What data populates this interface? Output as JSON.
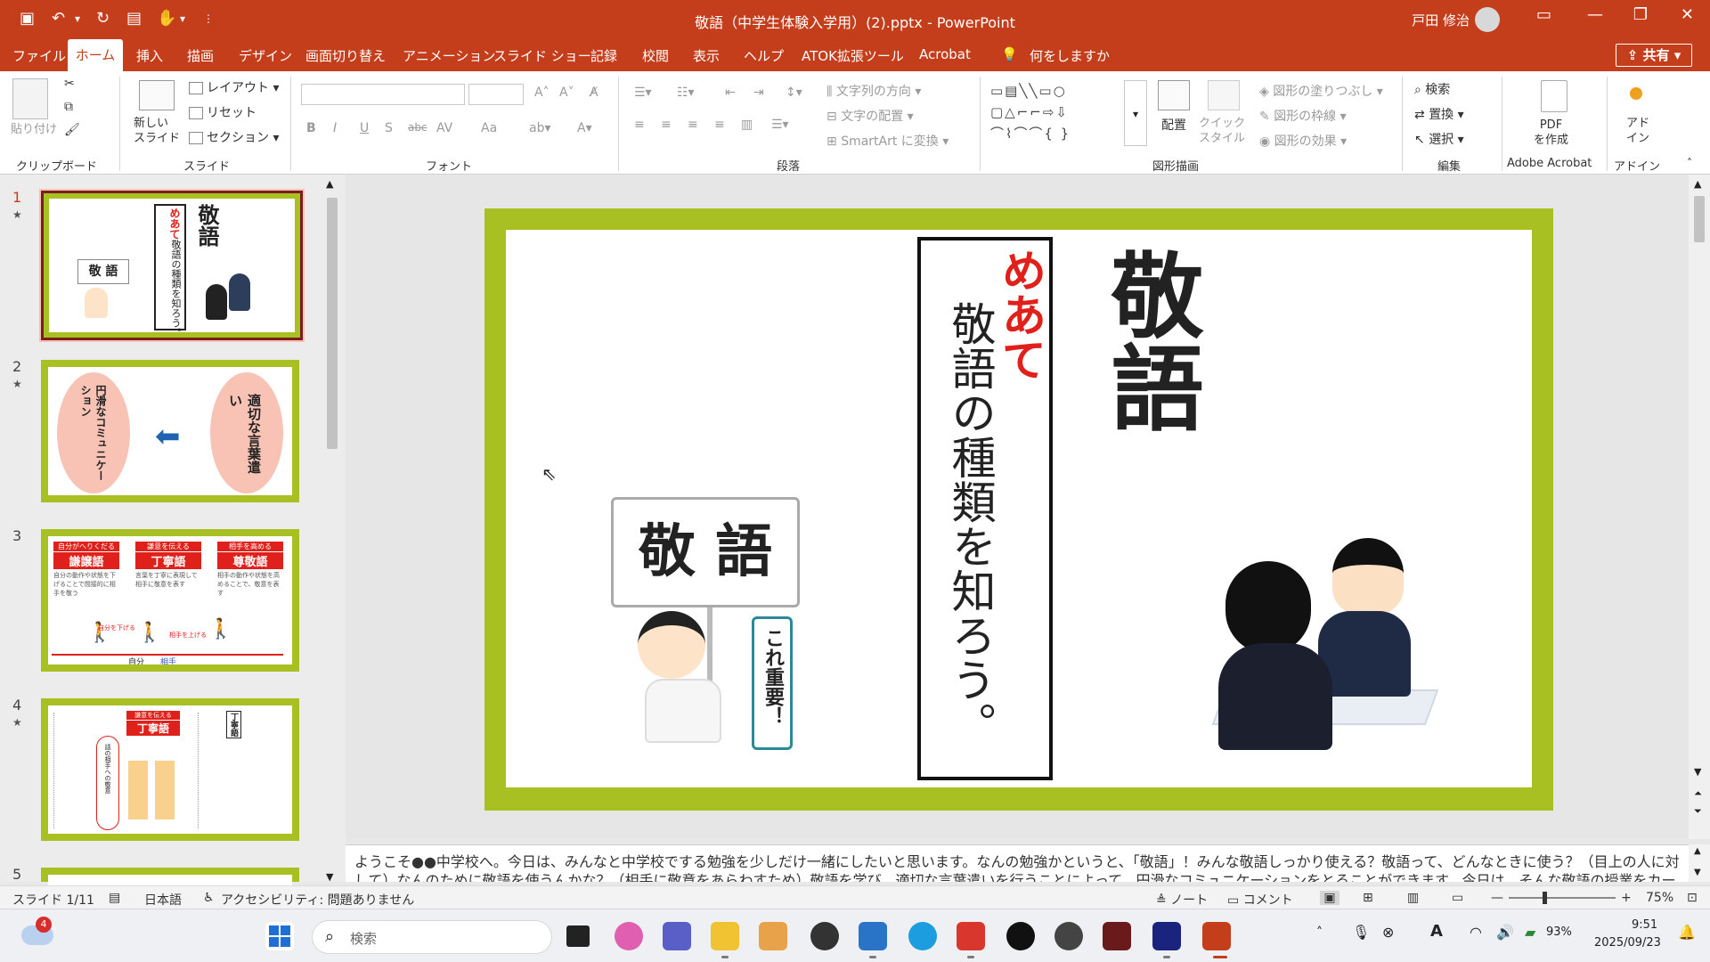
{
  "window": {
    "title": "敬語（中学生体験入学用）(2).pptx  -  PowerPoint",
    "user": "戸田 修治",
    "colors": {
      "brand": "#c43e1c",
      "slide_border": "#a8c022",
      "accent_red": "#e0201a"
    }
  },
  "quick_access": [
    "save-icon",
    "undo-icon",
    "redo-icon",
    "present-icon",
    "touch-mode-icon"
  ],
  "menu": {
    "tabs": [
      "ファイル",
      "ホーム",
      "挿入",
      "描画",
      "デザイン",
      "画面切り替え",
      "アニメーション",
      "スライド ショー",
      "記録",
      "校閲",
      "表示",
      "ヘルプ",
      "ATOK拡張ツール",
      "Acrobat"
    ],
    "active": "ホーム",
    "tell_me": "何をしますか",
    "share": "共有"
  },
  "ribbon": {
    "clipboard": {
      "label": "クリップボード",
      "paste": "貼り付け"
    },
    "slides": {
      "label": "スライド",
      "new_slide": "新しい\nスライド",
      "layout": "レイアウト",
      "reset": "リセット",
      "section": "セクション"
    },
    "font": {
      "label": "フォント",
      "buttons": [
        "B",
        "I",
        "U",
        "S",
        "abc",
        "AV",
        "Aa"
      ]
    },
    "paragraph": {
      "label": "段落",
      "text_direction": "文字列の方向",
      "align_text": "文字の配置",
      "smartart": "SmartArt に変換"
    },
    "drawing": {
      "label": "図形描画",
      "arrange": "配置",
      "quick_styles": "クイック\nスタイル",
      "shape_fill": "図形の塗りつぶし",
      "shape_outline": "図形の枠線",
      "shape_effects": "図形の効果"
    },
    "editing": {
      "label": "編集",
      "find": "検索",
      "replace": "置換",
      "select": "選択"
    },
    "acrobat": {
      "label": "Adobe Acrobat",
      "create_pdf": "PDF\nを作成"
    },
    "addins": {
      "label": "アドイン",
      "addins": "アド\nイン"
    }
  },
  "thumbnails": [
    {
      "num": "1",
      "star": "★",
      "title": "敬語",
      "goal_label": "めあて",
      "goal_text": "敬語の種類を知ろう。",
      "sign": "敬 語",
      "bubble": "これ重要！"
    },
    {
      "num": "2",
      "star": "★",
      "left_text": "円滑なコミュニケーション",
      "right_text": "適切な言葉遣い"
    },
    {
      "num": "3",
      "star": "",
      "cards": [
        {
          "caption": "自分がへりくだる",
          "title": "謙譲語",
          "body": "自分の動作や状態を下げることで間接的に相手を敬う"
        },
        {
          "caption": "謙意を伝える",
          "title": "丁寧語",
          "body": "言葉を丁寧に表現して相手に敬意を表す"
        },
        {
          "caption": "相手を高める",
          "title": "尊敬語",
          "body": "相手の動作や状態を高めることで、敬意を表す"
        }
      ],
      "arrow_down": "自分を下げる",
      "arrow_up": "相手を上げる",
      "self": "自分",
      "other": "相手"
    },
    {
      "num": "4",
      "star": "★",
      "card_caption": "謙意を伝える",
      "card_title": "丁寧語",
      "side_label": "丁寧語",
      "oval_text": "話の相手への敬意"
    },
    {
      "num": "5",
      "star": ""
    }
  ],
  "slide": {
    "title": "敬語",
    "goal_label": "めあて",
    "goal_text": "敬語の種類を知ろう。",
    "sign_text": "敬 語",
    "bubble_text": "これ重要！"
  },
  "notes": "ようこそ●●中学校へ。今日は、みんなと中学校でする勉強を少しだけ一緒にしたいと思います。なんの勉強かというと、「敬語」！みんな敬語しっかり使える？敬語って、どんなときに使う？（目上の人に対して）なんのために敬語を使うんかな？（相手に敬意をあらわすため）敬語を学び、適切な言葉遣いを行うことによって、円滑なコミュニケーションをとることができます。今日は、そんな敬語の授業をカードゲームもまじ",
  "status": {
    "slide": "スライド 1/11",
    "language": "日本語",
    "accessibility": "アクセシビリティ: 問題ありません",
    "notes": "ノート",
    "comments": "コメント",
    "zoom": "75%"
  },
  "taskbar": {
    "search_placeholder": "検索",
    "notification_badge": "4",
    "battery": "93%",
    "time": "9:51",
    "date": "2025/09/23"
  }
}
